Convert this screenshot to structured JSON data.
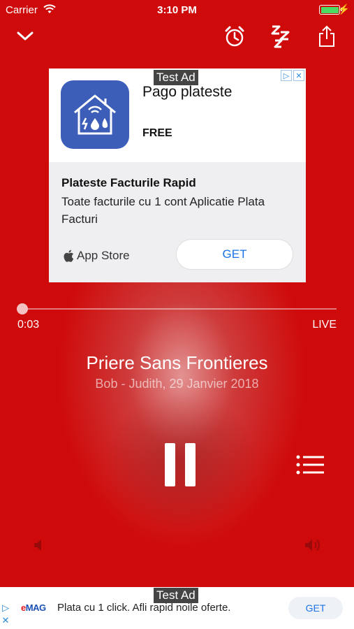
{
  "status_bar": {
    "carrier": "Carrier",
    "time": "3:10 PM",
    "battery_color": "#4cd964"
  },
  "top_controls": {
    "close_icon": "chevron-down-icon",
    "alarm_icon": "alarm-clock-icon",
    "sleep_icon": "sleep-timer-icon",
    "share_icon": "share-icon"
  },
  "ad": {
    "test_label": "Test Ad",
    "app_title": "Pago plateste",
    "price": "FREE",
    "headline": "Plateste Facturile Rapid",
    "body": "Toate facturile cu 1 cont Aplicatie Plata Facturi",
    "store_label": "App Store",
    "cta_label": "GET",
    "adchoices_icon": "adchoices-icon"
  },
  "player": {
    "progress_fraction": 0.0,
    "elapsed": "0:03",
    "live_label": "LIVE",
    "title": "Priere Sans Frontieres",
    "subtitle": "Bob - Judith, 29 Janvier 2018",
    "accent_color": "#cf0a0a"
  },
  "banner": {
    "test_label": "Test Ad",
    "logo_e": "e",
    "logo_rest": "MAG",
    "text": "Plata cu 1 click. Afli rapid noile oferte.",
    "cta_label": "GET"
  }
}
